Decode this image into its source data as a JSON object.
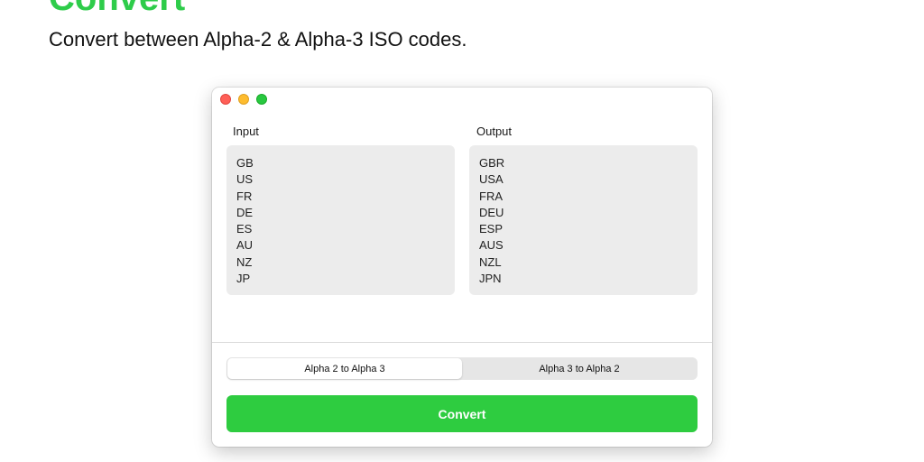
{
  "hero": {
    "title": "Convert",
    "subtitle": "Convert between Alpha-2 & Alpha-3 ISO codes."
  },
  "window": {
    "input": {
      "label": "Input",
      "codes": [
        "GB",
        "US",
        "FR",
        "DE",
        "ES",
        "AU",
        "NZ",
        "JP"
      ]
    },
    "output": {
      "label": "Output",
      "codes": [
        "GBR",
        "USA",
        "FRA",
        "DEU",
        "ESP",
        "AUS",
        "NZL",
        "JPN"
      ]
    },
    "mode": {
      "options": [
        "Alpha 2 to Alpha 3",
        "Alpha 3 to Alpha 2"
      ],
      "selected": "Alpha 2 to Alpha 3"
    },
    "convert_label": "Convert"
  },
  "colors": {
    "accent_green": "#2ecc40",
    "close": "#ff5f57",
    "minimize": "#febc2e",
    "maximize": "#28c840"
  }
}
